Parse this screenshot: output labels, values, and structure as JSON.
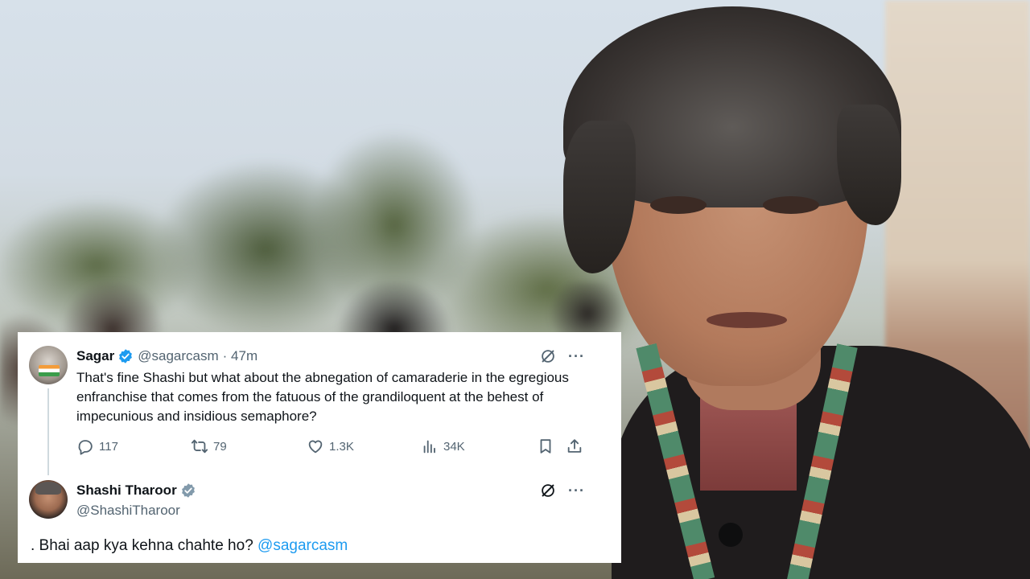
{
  "tweet": {
    "author_name": "Sagar",
    "author_handle": "@sagarcasm",
    "time": "· 47m",
    "text": "That's fine Shashi but what about the abnegation of camaraderie in the egregious enfranchise that comes from the fatuous of the grandiloquent at the behest of impecunious and insidious semaphore?",
    "replies": "117",
    "retweets": "79",
    "likes": "1.3K",
    "views": "34K",
    "more_label": "···"
  },
  "reply": {
    "author_name": "Shashi Tharoor",
    "author_handle": "@ShashiTharoor",
    "text": ". Bhai aap kya kehna chahte ho?",
    "mention": "@sagarcasm",
    "more_label": "···"
  },
  "colors": {
    "verified": "#1d9bf0",
    "verified_gov": "#829aab",
    "text": "#0f1419",
    "muted": "#536471",
    "link": "#1d9bf0"
  },
  "icons": [
    "grok-icon",
    "more-icon",
    "reply-icon",
    "retweet-icon",
    "like-icon",
    "views-icon",
    "bookmark-icon",
    "share-icon",
    "verified-badge-icon"
  ]
}
